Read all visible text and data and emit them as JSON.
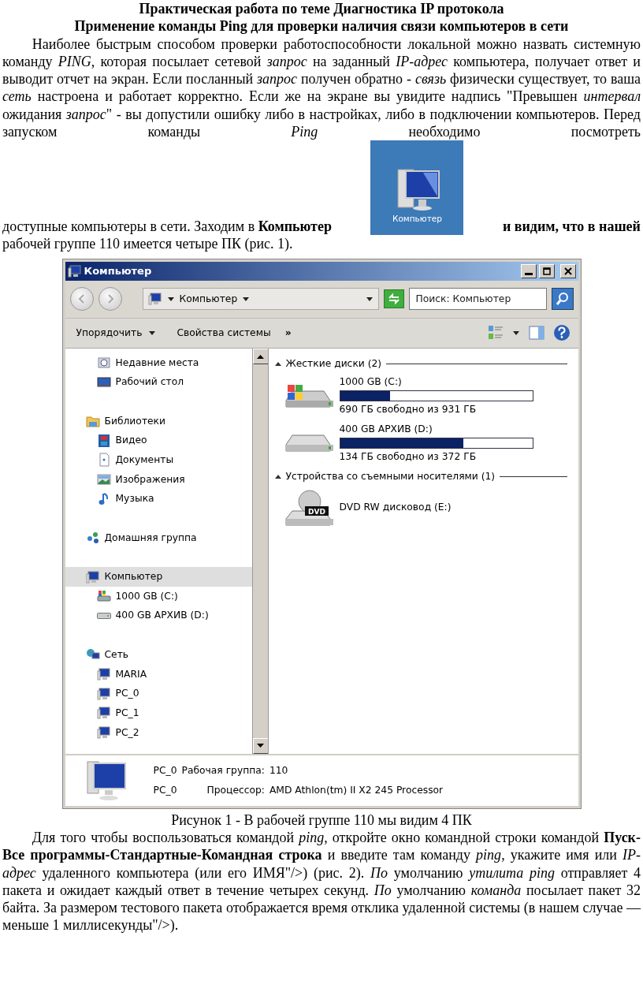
{
  "document": {
    "title_lines": [
      "Практическая работа по теме Диагностика IP протокола",
      "Применение команды Ping для проверки наличия связи компьютеров в сети"
    ],
    "paragraph_1": "Наиболее быстрым способом проверки работоспособности локальной можно назвать системную команду *PING*, которая посылает сетевой *запрос* на заданный *IP-адрес* компьютера, получает ответ и выводит отчет на экран. Если посланный *запрос* получен обратно - *связь* физически существует, то ваша *сеть* настроена и работает корректно. Если же на экране вы увидите надпись \"Превышен *интервал* ожидания *запрос*\" - вы допустили ошибку либо в настройках, либо в подключении компьютеров. Перед запуском команды *Ping* необходимо посмотреть",
    "line_before_icon": "доступные компьютеры в сети. Заходим в **Компьютер**",
    "inline_icon": {
      "label": "Компьютер"
    },
    "line_after_icon": "и видим, что в нашей",
    "paragraph_1_end": "рабочей группе 110 имеется четыре ПК (рис. 1).",
    "caption": "Рисунок 1 - В рабочей группе 110 мы видим 4 ПК",
    "paragraph_2": "Для того чтобы воспользоваться командой *ping*, откройте окно командной строки командой **Пуск-Все программы-Стандартные-Командная строка** и введите там команду *ping*, укажите имя или *IP-адрес* удаленного компьютера (или его ИМЯ\"/>) (рис. 2). *По* умолчанию *утилита ping* отправляет 4 пакета и ожидает каждый ответ в течение четырех секунд. *По* умолчанию *команда* посылает пакет 32 байта. За размером тестового пакета отображается время отклика удаленной системы (в нашем случае — меньше 1 миллисекунды\"/>)."
  },
  "window": {
    "title": "Компьютер",
    "address": "Компьютер",
    "search": {
      "placeholder": "Поиск: Компьютер"
    },
    "toolbar": {
      "organize": "Упорядочить",
      "system_properties": "Свойства системы",
      "more": "»"
    },
    "sidebar": {
      "sections": [
        {
          "children": [
            {
              "label": "Недавние места",
              "kind": "recent",
              "selected": false
            },
            {
              "label": "Рабочий стол",
              "kind": "desktop",
              "selected": false
            }
          ]
        },
        {
          "label": "Библиотеки",
          "kind": "library",
          "selected": false,
          "children": [
            {
              "label": "Видео",
              "kind": "video",
              "selected": false
            },
            {
              "label": "Документы",
              "kind": "documents",
              "selected": false
            },
            {
              "label": "Изображения",
              "kind": "images",
              "selected": false
            },
            {
              "label": "Музыка",
              "kind": "music",
              "selected": false
            }
          ]
        },
        {
          "label": "Домашняя группа",
          "kind": "homegroup",
          "selected": false
        },
        {
          "label": "Компьютер",
          "kind": "computer",
          "selected": true,
          "children": [
            {
              "label": "1000 GB (C:)",
              "kind": "system-drive",
              "selected": false
            },
            {
              "label": "400 GB АРХИВ (D:)",
              "kind": "drive",
              "selected": false
            }
          ]
        },
        {
          "label": "Сеть",
          "kind": "network",
          "selected": false,
          "children": [
            {
              "label": "MARIA",
              "kind": "pc",
              "selected": false
            },
            {
              "label": "PC_0",
              "kind": "pc",
              "selected": false
            },
            {
              "label": "PC_1",
              "kind": "pc",
              "selected": false
            },
            {
              "label": "PC_2",
              "kind": "pc",
              "selected": false
            }
          ]
        }
      ]
    },
    "groups": [
      {
        "title": "Жесткие диски (2)",
        "items": [
          {
            "kind": "system-drive",
            "name": "1000 GB (C:)",
            "level": 0.26,
            "reading": "690 ГБ свободно из 931 ГБ"
          },
          {
            "kind": "drive",
            "name": "400 GB АРХИВ (D:)",
            "level": 0.64,
            "reading": "134 ГБ свободно из 372 ГБ"
          }
        ]
      },
      {
        "title": "Устройства со съемными носителями (1)",
        "items": [
          {
            "kind": "dvd",
            "name": "DVD RW дисковод (E:)",
            "dvd_label": "DVD"
          }
        ]
      }
    ],
    "details": [
      {
        "name": "PC_0",
        "label": "Рабочая группа:",
        "value": "110"
      },
      {
        "name": "PC_0",
        "label": "Процессор:",
        "value": "AMD Athlon(tm) II X2 245 Processor"
      }
    ]
  }
}
